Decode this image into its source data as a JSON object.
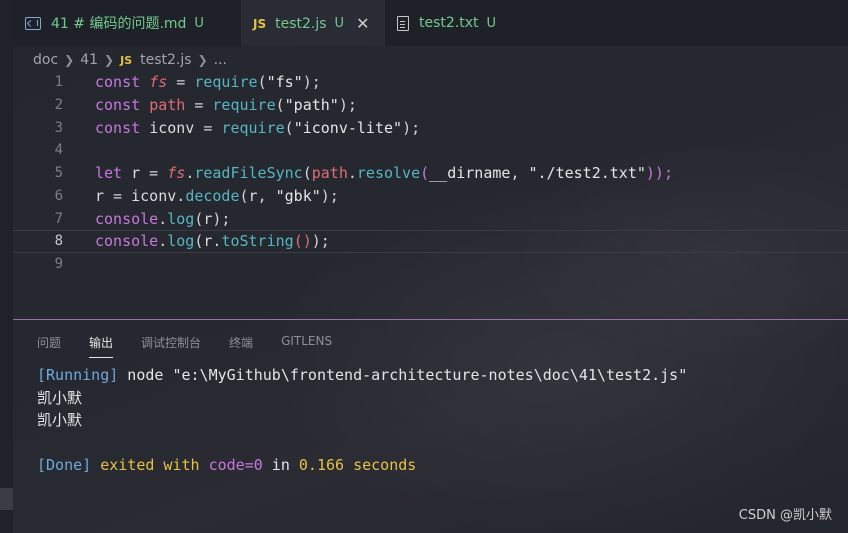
{
  "tabs": [
    {
      "label": "41 # 编码的问题.md",
      "status": "U",
      "icon": "markdown-icon",
      "active": false
    },
    {
      "label": "test2.js",
      "status": "U",
      "icon": "js-icon",
      "icon_text": "JS",
      "active": true
    },
    {
      "label": "test2.txt",
      "status": "U",
      "icon": "document-icon",
      "active": false
    }
  ],
  "breadcrumb": {
    "items": [
      "doc",
      "41",
      "test2.js",
      "..."
    ],
    "js_icon_text": "JS"
  },
  "editor": {
    "line_numbers": [
      "1",
      "2",
      "3",
      "4",
      "5",
      "6",
      "7",
      "8",
      "9"
    ],
    "current_line": 8,
    "lines": [
      [
        {
          "t": "const ",
          "c": "kw"
        },
        {
          "t": "fs",
          "c": "var italic"
        },
        {
          "t": " = ",
          "c": "pl"
        },
        {
          "t": "require",
          "c": "req"
        },
        {
          "t": "(",
          "c": "pl"
        },
        {
          "t": "\"fs\"",
          "c": "strd"
        },
        {
          "t": ");",
          "c": "pl"
        }
      ],
      [
        {
          "t": "const ",
          "c": "kw"
        },
        {
          "t": "path",
          "c": "var"
        },
        {
          "t": " = ",
          "c": "pl"
        },
        {
          "t": "require",
          "c": "req"
        },
        {
          "t": "(",
          "c": "pl"
        },
        {
          "t": "\"path\"",
          "c": "strd"
        },
        {
          "t": ");",
          "c": "pl"
        }
      ],
      [
        {
          "t": "const ",
          "c": "kw"
        },
        {
          "t": "iconv",
          "c": "id"
        },
        {
          "t": " = ",
          "c": "pl"
        },
        {
          "t": "require",
          "c": "req"
        },
        {
          "t": "(",
          "c": "pl"
        },
        {
          "t": "\"iconv-lite\"",
          "c": "strd"
        },
        {
          "t": ");",
          "c": "pl"
        }
      ],
      [],
      [
        {
          "t": "let ",
          "c": "kw"
        },
        {
          "t": "r",
          "c": "id"
        },
        {
          "t": " = ",
          "c": "pl"
        },
        {
          "t": "fs",
          "c": "var italic"
        },
        {
          "t": ".",
          "c": "pl"
        },
        {
          "t": "readFileSync",
          "c": "prop"
        },
        {
          "t": "(",
          "c": "pl"
        },
        {
          "t": "path",
          "c": "var"
        },
        {
          "t": ".",
          "c": "pl"
        },
        {
          "t": "resolve",
          "c": "prop"
        },
        {
          "t": "(",
          "c": "kw"
        },
        {
          "t": "__dirname",
          "c": "plain"
        },
        {
          "t": ", ",
          "c": "pl"
        },
        {
          "t": "\"./test2.txt\"",
          "c": "strd"
        },
        {
          "t": "));",
          "c": "kw"
        }
      ],
      [
        {
          "t": "r",
          "c": "id"
        },
        {
          "t": " = ",
          "c": "pl"
        },
        {
          "t": "iconv",
          "c": "id"
        },
        {
          "t": ".",
          "c": "pl"
        },
        {
          "t": "decode",
          "c": "prop"
        },
        {
          "t": "(",
          "c": "pl"
        },
        {
          "t": "r",
          "c": "id"
        },
        {
          "t": ", ",
          "c": "pl"
        },
        {
          "t": "\"gbk\"",
          "c": "strd"
        },
        {
          "t": ");",
          "c": "pl"
        }
      ],
      [
        {
          "t": "console",
          "c": "kw"
        },
        {
          "t": ".",
          "c": "pl"
        },
        {
          "t": "log",
          "c": "prop"
        },
        {
          "t": "(",
          "c": "pl"
        },
        {
          "t": "r",
          "c": "id"
        },
        {
          "t": ");",
          "c": "pl"
        }
      ],
      [
        {
          "t": "console",
          "c": "kw"
        },
        {
          "t": ".",
          "c": "pl"
        },
        {
          "t": "log",
          "c": "prop"
        },
        {
          "t": "(",
          "c": "pl"
        },
        {
          "t": "r",
          "c": "id"
        },
        {
          "t": ".",
          "c": "pl"
        },
        {
          "t": "toString",
          "c": "prop"
        },
        {
          "t": "()",
          "c": "var"
        },
        {
          "t": ");",
          "c": "pl"
        }
      ],
      []
    ]
  },
  "panel": {
    "tabs": [
      "问题",
      "输出",
      "调试控制台",
      "终端",
      "GITLENS"
    ],
    "active_tab": 1,
    "output": [
      [
        {
          "t": "[Running]",
          "c": "o-tag"
        },
        {
          "t": " node \"e:\\MyGithub\\frontend-architecture-notes\\doc\\41\\test2.js\"",
          "c": "o-node"
        }
      ],
      [
        {
          "t": "凯小默",
          "c": "o-node"
        }
      ],
      [
        {
          "t": "凯小默",
          "c": "o-node"
        }
      ],
      [],
      [
        {
          "t": "[Done]",
          "c": "o-tag"
        },
        {
          "t": " exited with ",
          "c": "o-exited"
        },
        {
          "t": "code=0",
          "c": "o-code"
        },
        {
          "t": " in ",
          "c": "o-node"
        },
        {
          "t": "0.166",
          "c": "o-num"
        },
        {
          "t": " seconds",
          "c": "o-exited"
        }
      ]
    ]
  },
  "watermark": "CSDN @凯小默",
  "colors": {
    "keyword": "#c678dd",
    "variable": "#e06c75",
    "function": "#56b6c2",
    "untracked": "#73c991",
    "panel_border": "#9a6fb0"
  }
}
